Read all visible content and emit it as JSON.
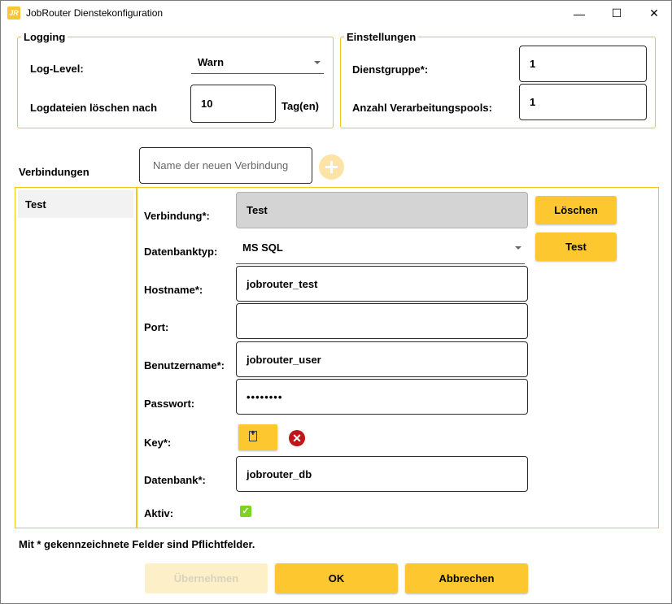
{
  "window": {
    "app_icon_text": "JR",
    "title": "JobRouter Dienstekonfiguration",
    "minimize_glyph": "—",
    "maximize_glyph": "☐",
    "close_glyph": "✕"
  },
  "logging": {
    "legend": "Logging",
    "log_level_label": "Log-Level:",
    "log_level_value": "Warn",
    "delete_logs_label": "Logdateien löschen nach",
    "delete_logs_value": "10",
    "delete_logs_unit": "Tag(en)"
  },
  "settings": {
    "legend": "Einstellungen",
    "service_group_label": "Dienstgruppe*:",
    "service_group_value": "1",
    "pool_count_label": "Anzahl Verarbeitungspools:",
    "pool_count_value": "1"
  },
  "connections": {
    "label": "Verbindungen",
    "new_placeholder": "Name der neuen Verbindung",
    "items": [
      "Test"
    ]
  },
  "connection_form": {
    "connection_label": "Verbindung*:",
    "connection_value": "Test",
    "db_type_label": "Datenbanktyp:",
    "db_type_value": "MS SQL",
    "hostname_label": "Hostname*:",
    "hostname_value": "jobrouter_test",
    "port_label": "Port:",
    "port_value": "",
    "username_label": "Benutzername*:",
    "username_value": "jobrouter_user",
    "password_label": "Passwort:",
    "password_value": "••••••••",
    "key_label": "Key*:",
    "database_label": "Datenbank*:",
    "database_value": "jobrouter_db",
    "active_label": "Aktiv:",
    "active_checked_glyph": "✓",
    "clear_key_glyph": "✕",
    "delete_button": "Löschen",
    "test_button": "Test"
  },
  "footnote": "Mit * gekennzeichnete Felder sind Pflichtfelder.",
  "buttons": {
    "apply": "Übernehmen",
    "ok": "OK",
    "cancel": "Abbrechen"
  }
}
